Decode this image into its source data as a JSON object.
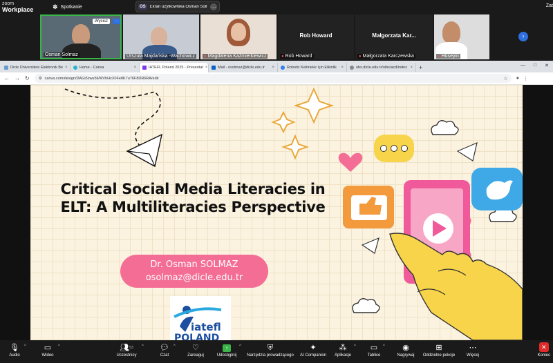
{
  "zoom": {
    "logo_line1": "zoom",
    "logo_line2": "Workplace",
    "meeting_label": "Spotkanie",
    "share_badge": "OS",
    "share_text": "Ekran użytkownika Osman Solma",
    "right_text": "Zat"
  },
  "participants": [
    {
      "name": "Osman Solmaz",
      "active": true,
      "muted": false,
      "controls": {
        "mute_label": "Wycisz",
        "more_label": "···"
      }
    },
    {
      "name": "Urszula Majdańska -Wachowicz",
      "muted": false
    },
    {
      "name": "Magdalena Kaźmierkiewicz",
      "muted": true
    },
    {
      "name": "Rob Howard",
      "muted": true,
      "display_name": "Rob Howard"
    },
    {
      "name": "Małgorzata Karczewska",
      "muted": true,
      "display_name": "Małgorzata  Kar..."
    },
    {
      "name": "Hüseyin",
      "muted": true
    }
  ],
  "browser": {
    "tabs": [
      {
        "label": "Dicle Üniversitesi Elektronik Be",
        "color": "#6b9bd1",
        "active": false
      },
      {
        "label": "Home - Canva",
        "color": "#28b4c8",
        "active": false
      },
      {
        "label": "IATEFL Poland 2025 - Presentat",
        "color": "#7c3aed",
        "active": true
      },
      {
        "label": "Mail - osolmaz@dicle.edu.tr",
        "color": "#0a64c8",
        "active": false
      },
      {
        "label": "Robotic Kelimeler için Etkinlik",
        "color": "#2f80ed",
        "active": false
      },
      {
        "label": "obs.dicle.edu.tr/oibs/acd/index",
        "color": "#888888",
        "active": false
      }
    ],
    "new_tab": "+",
    "url": "canva.com/design/DAGi5zwu5lI/MVhHzX0Fe8K7u76F8DR6RA/edit"
  },
  "slide": {
    "title_line1": "Critical Social Media Literacies in",
    "title_line2": "ELT: A Multiliteracies Perspective",
    "author": "Dr. Osman SOLMAZ",
    "email": "osolmaz@dicle.edu.tr",
    "logo_line1": "iatefl",
    "logo_line2": "POLAND"
  },
  "toolbar": {
    "audio": "Audio",
    "video": "Wideo",
    "participants": "Uczestnicy",
    "participants_count": "53",
    "chat": "Czat",
    "react": "Zareaguj",
    "share": "Udostępnij",
    "host_tools": "Narzędzia prowadzącego",
    "ai": "AI Companion",
    "apps": "Aplikacje",
    "whiteboards": "Tablice",
    "record": "Nagrywaj",
    "breakout": "Oddzielne pokoje",
    "more": "Więcej",
    "end": "Koniec"
  }
}
